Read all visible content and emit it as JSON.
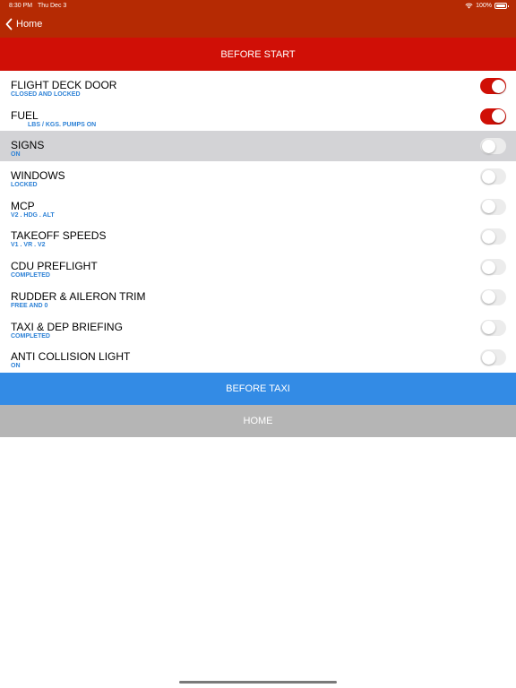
{
  "status_bar": {
    "time": "8:30 PM",
    "date": "Thu Dec 3",
    "battery": "100%",
    "wifi_icon": "wifi-icon",
    "battery_icon": "battery-icon"
  },
  "nav": {
    "back_label": "Home",
    "back_icon": "chevron-left-icon"
  },
  "section_title": "BEFORE START",
  "items": [
    {
      "title": "FLIGHT DECK DOOR",
      "subtitle": "CLOSED AND LOCKED",
      "on": true,
      "highlight": false
    },
    {
      "title": "FUEL",
      "subtitle": "LBS / KGS. PUMPS ON",
      "on": true,
      "highlight": false
    },
    {
      "title": "SIGNS",
      "subtitle": "ON",
      "on": false,
      "highlight": true
    },
    {
      "title": "WINDOWS",
      "subtitle": "LOCKED",
      "on": false,
      "highlight": false
    },
    {
      "title": "MCP",
      "subtitle": "V2          . HDG          . ALT",
      "on": false,
      "highlight": false
    },
    {
      "title": "TAKEOFF SPEEDS",
      "subtitle": "V1          . VR          . V2",
      "on": false,
      "highlight": false
    },
    {
      "title": "CDU PREFLIGHT",
      "subtitle": "COMPLETED",
      "on": false,
      "highlight": false
    },
    {
      "title": "RUDDER & AILERON TRIM",
      "subtitle": "FREE AND 0",
      "on": false,
      "highlight": false
    },
    {
      "title": "TAXI & DEP BRIEFING",
      "subtitle": "COMPLETED",
      "on": false,
      "highlight": false
    },
    {
      "title": "ANTI COLLISION LIGHT",
      "subtitle": "ON",
      "on": false,
      "highlight": false
    }
  ],
  "buttons": {
    "next_label": "BEFORE TAXI",
    "home_label": "HOME"
  },
  "colors": {
    "nav_bar": "#b52a03",
    "header": "#d00f06",
    "toggle_on": "#d00f06",
    "subtitle": "#2e82d6",
    "next_button": "#338be5",
    "home_button": "#b5b5b5",
    "highlight_row": "#d3d3d6"
  }
}
